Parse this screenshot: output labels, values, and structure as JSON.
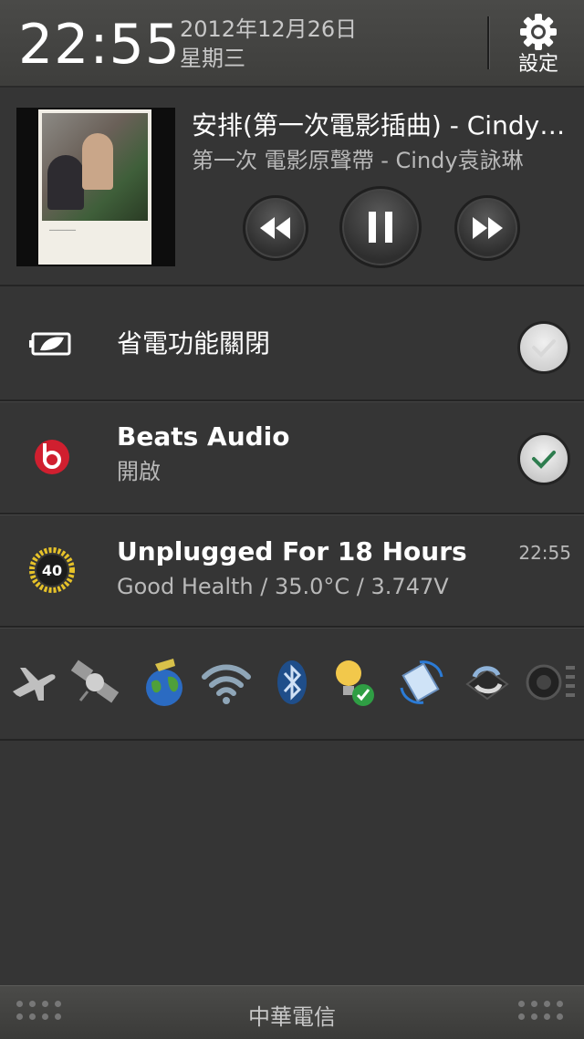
{
  "status": {
    "time": "22:55",
    "date": "2012年12月26日",
    "weekday": "星期三",
    "settings_label": "設定"
  },
  "media": {
    "title": "安排(第一次電影插曲) - Cindy袁詠琳",
    "artist": "第一次 電影原聲帶 - Cindy袁詠琳",
    "controls": [
      "rewind-icon",
      "pause-icon",
      "fast-forward-icon"
    ]
  },
  "rows": [
    {
      "title": "省電功能關閉",
      "subtitle": "",
      "checked": true,
      "icon": "power-saver-icon"
    },
    {
      "title": "Beats Audio",
      "subtitle": "開啟",
      "checked": true,
      "icon": "beats-audio-icon"
    },
    {
      "title": "Unplugged For 18 Hours",
      "subtitle": "Good Health / 35.0°C / 3.747V",
      "time": "22:55",
      "icon": "battery-gauge-icon",
      "badge": "40"
    }
  ],
  "quick_toggles": [
    "airplane-icon",
    "gps-satellite-icon",
    "mobile-data-globe-icon",
    "wifi-icon",
    "bluetooth-icon",
    "flashlight-icon",
    "auto-rotate-icon",
    "sync-icon",
    "sound-icon"
  ],
  "footer": {
    "carrier": "中華電信"
  },
  "colors": {
    "background": "#353535",
    "beats_red": "#d01f2f",
    "gauge_yellow": "#e6c229",
    "check_green": "#2e7d4f"
  }
}
